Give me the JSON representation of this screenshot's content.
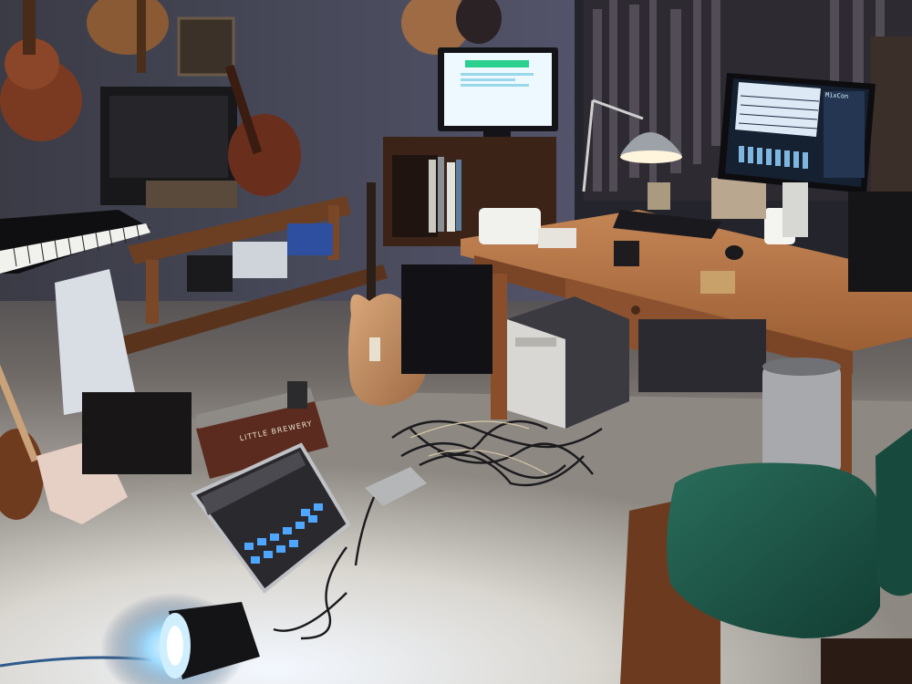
{
  "scene": {
    "type": "home music studio photo",
    "colors": {
      "wall": "#2f3038",
      "floor": "#d9d4cc",
      "desk": "#a3633a",
      "chair": "#1f5a4a",
      "monitor_screen": "#e7f6ff",
      "light_glow": "#7fd6ff"
    }
  },
  "pedalboard": {
    "brand_text": "LITTLE BREWERY"
  },
  "monitor_right": {
    "logo_text": "MixCon"
  }
}
